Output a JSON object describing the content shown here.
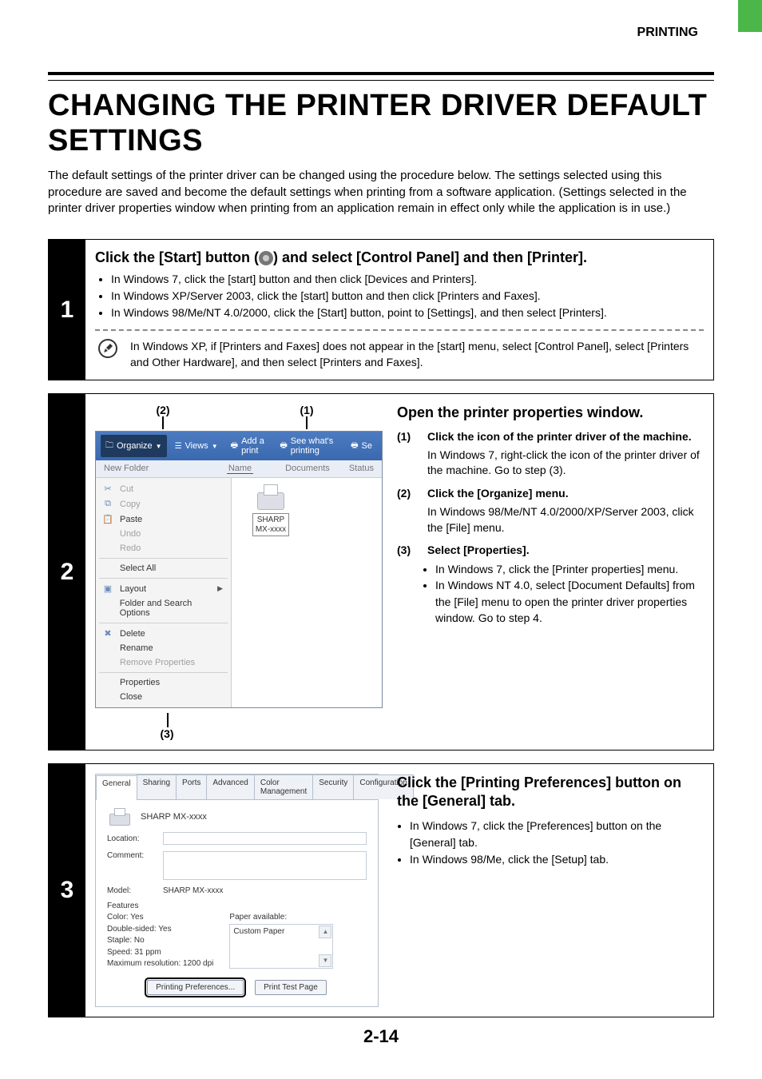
{
  "header_label": "PRINTING",
  "title": "CHANGING THE PRINTER DRIVER DEFAULT SETTINGS",
  "intro": "The default settings of the printer driver can be changed using the procedure below. The settings selected using this procedure are saved and become the default settings when printing from a software application. (Settings selected in the printer driver properties window when printing from an application remain in effect only while the application is in use.)",
  "page_number": "2-14",
  "step1": {
    "num": "1",
    "title_pre": "Click the [Start] button (",
    "title_post": ") and select [Control Panel] and then [Printer].",
    "bullets": [
      "In Windows 7, click the [start] button and then click [Devices and Printers].",
      "In Windows XP/Server 2003, click the [start] button and then click [Printers and Faxes].",
      "In Windows 98/Me/NT 4.0/2000, click the [Start] button, point to [Settings], and then select [Printers]."
    ],
    "note": "In Windows XP, if [Printers and Faxes] does not appear in the [start] menu, select [Control Panel], select [Printers and Other Hardware], and then select [Printers and Faxes]."
  },
  "step2": {
    "num": "2",
    "callouts": {
      "c1": "(1)",
      "c2": "(2)",
      "c3": "(3)"
    },
    "toolbar": {
      "organize": "Organize",
      "views": "Views",
      "add_printer": "Add a print",
      "see_printing": "See what's printing",
      "se": "Se"
    },
    "subbar_left": "New Folder",
    "columns": {
      "name": "Name",
      "documents": "Documents",
      "status": "Status"
    },
    "menu": {
      "cut": "Cut",
      "copy": "Copy",
      "paste": "Paste",
      "undo": "Undo",
      "redo": "Redo",
      "select_all": "Select All",
      "layout": "Layout",
      "folder_options": "Folder and Search Options",
      "delete": "Delete",
      "rename": "Rename",
      "remove_props": "Remove Properties",
      "properties": "Properties",
      "close": "Close"
    },
    "printer_name_line1": "SHARP",
    "printer_name_line2": "MX-xxxx",
    "right_heading": "Open the printer properties window.",
    "sub1_num": "(1)",
    "sub1_title": "Click the icon of the printer driver of the machine.",
    "sub1_text": "In Windows 7, right-click the icon of the printer driver of the machine. Go to step (3).",
    "sub2_num": "(2)",
    "sub2_title": "Click the [Organize] menu.",
    "sub2_text": "In Windows 98/Me/NT 4.0/2000/XP/Server 2003, click the [File] menu.",
    "sub3_num": "(3)",
    "sub3_title": "Select [Properties].",
    "sub3_bullets": [
      "In Windows 7, click the [Printer properties] menu.",
      "In Windows NT 4.0, select [Document Defaults] from the [File] menu to open the printer driver properties window. Go to step 4."
    ]
  },
  "step3": {
    "num": "3",
    "tabs": [
      "General",
      "Sharing",
      "Ports",
      "Advanced",
      "Color Management",
      "Security",
      "Configuration"
    ],
    "printer_name": "SHARP MX-xxxx",
    "labels": {
      "location": "Location:",
      "comment": "Comment:",
      "model": "Model:",
      "features": "Features",
      "paper_available": "Paper available:"
    },
    "features": {
      "color": "Color: Yes",
      "double_sided": "Double-sided: Yes",
      "staple": "Staple: No",
      "speed": "Speed: 31 ppm",
      "max_res": "Maximum resolution: 1200 dpi"
    },
    "paper_item": "Custom Paper",
    "buttons": {
      "preferences": "Printing Preferences...",
      "test_page": "Print Test Page"
    },
    "right_heading": "Click the [Printing Preferences] button on the [General] tab.",
    "bullets": [
      "In Windows 7, click the [Preferences] button on the [General] tab.",
      "In Windows 98/Me, click the [Setup] tab."
    ]
  }
}
